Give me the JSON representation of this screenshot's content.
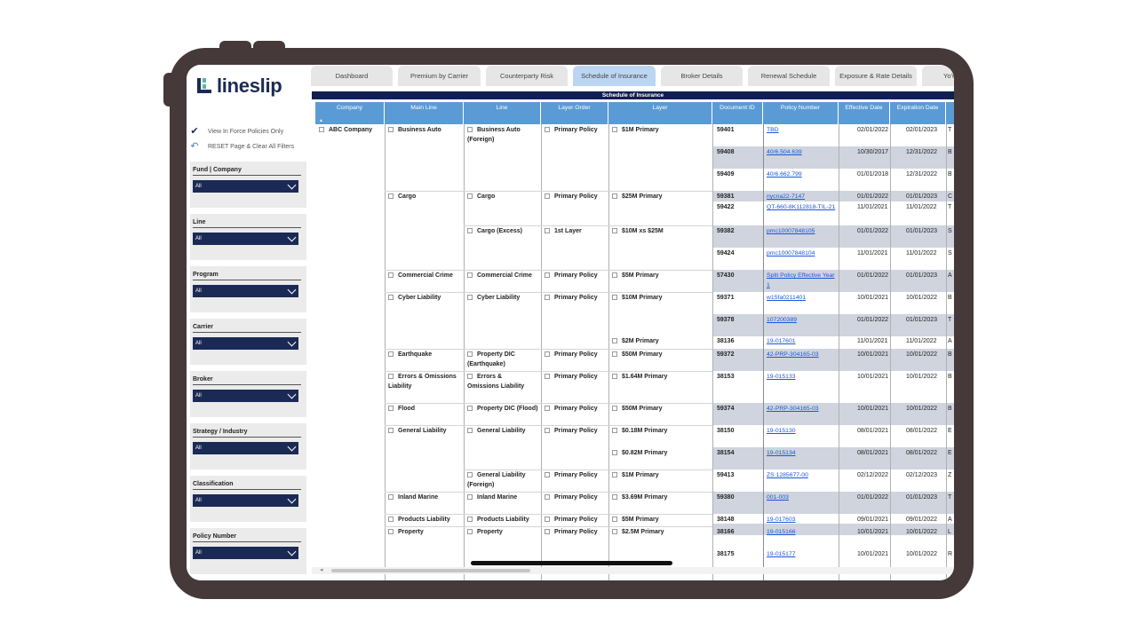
{
  "app": {
    "logo_text": "lineslip"
  },
  "sidebar": {
    "view_in_force": "View In Force Policies Only",
    "reset": "RESET Page & Clear All Filters",
    "filters": [
      {
        "label": "Fund | Company",
        "value": "All"
      },
      {
        "label": "Line",
        "value": "All"
      },
      {
        "label": "Program",
        "value": "All"
      },
      {
        "label": "Carrier",
        "value": "All"
      },
      {
        "label": "Broker",
        "value": "All"
      },
      {
        "label": "Strategy / Industry",
        "value": "All"
      },
      {
        "label": "Classification",
        "value": "All"
      },
      {
        "label": "Policy Number",
        "value": "All"
      }
    ]
  },
  "tabs": [
    {
      "label": "Dashboard"
    },
    {
      "label": "Premium by Carrier"
    },
    {
      "label": "Counterparty Risk"
    },
    {
      "label": "Schedule of Insurance",
      "active": true
    },
    {
      "label": "Broker Details"
    },
    {
      "label": "Renewal Schedule"
    },
    {
      "label": "Exposure & Rate Details"
    },
    {
      "label": "YoY"
    }
  ],
  "table": {
    "title": "Schedule of Insurance",
    "headers": [
      "Company",
      "Main Line",
      "Line",
      "Layer Order",
      "Layer",
      "Document ID",
      "Policy Number",
      "Effective Date",
      "Expiration Date"
    ],
    "company": "ABC Company",
    "main_lines": [
      "Business Auto",
      "Cargo",
      "Commercial Crime",
      "Cyber Liability",
      "Earthquake",
      "Errors & Omissions Liability",
      "Flood",
      "General Liability",
      "Inland Marine",
      "Products Liability",
      "Property"
    ],
    "lines": [
      "Business Auto (Foreign)",
      "Cargo",
      "Cargo (Excess)",
      "Commercial Crime",
      "Cyber Liability",
      "Property DIC (Earthquake)",
      "Errors & Omissions Liability",
      "Property DIC (Flood)",
      "General Liability",
      "General Liability (Foreign)",
      "Inland Marine",
      "Products Liability",
      "Property"
    ],
    "layer_orders": [
      "Primary Policy",
      "Primary Policy",
      "1st Layer",
      "Primary Policy",
      "Primary Policy",
      "Primary Policy",
      "Primary Policy",
      "Primary Policy",
      "Primary Policy",
      "Primary Policy",
      "Primary Policy",
      "Primary Policy",
      "Primary Policy"
    ],
    "layers": [
      "$1M Primary",
      "$25M Primary",
      "$10M xs $25M",
      "$5M Primary",
      "$10M Primary",
      "$2M Primary",
      "$50M Primary",
      "$1.64M Primary",
      "$50M Primary",
      "$0.18M Primary",
      "$0.82M Primary",
      "$1M Primary",
      "$3.69M Primary",
      "$5M Primary",
      "$2.5M Primary"
    ],
    "rows": [
      {
        "doc": "59401",
        "policy": "TBD",
        "eff": "02/01/2022",
        "exp": "02/01/2023",
        "extra": "T"
      },
      {
        "doc": "59408",
        "policy": "40/6.504.639",
        "eff": "10/30/2017",
        "exp": "12/31/2022",
        "extra": "B"
      },
      {
        "doc": "59409",
        "policy": "40/6.662.799",
        "eff": "01/01/2018",
        "exp": "12/31/2022",
        "extra": "B"
      },
      {
        "doc": "59381",
        "policy": "nycna22-7147",
        "eff": "01/01/2022",
        "exp": "01/01/2023",
        "extra": "C"
      },
      {
        "doc": "59422",
        "policy": "QT-660-8K112818-TIL-21",
        "eff": "11/01/2021",
        "exp": "11/01/2022",
        "extra": "T"
      },
      {
        "doc": "59382",
        "policy": "pmc10007848105",
        "eff": "01/01/2022",
        "exp": "01/01/2023",
        "extra": "S"
      },
      {
        "doc": "59424",
        "policy": "pmc10007848104",
        "eff": "11/01/2021",
        "exp": "11/01/2022",
        "extra": "S"
      },
      {
        "doc": "57430",
        "policy": "Split Policy Effective Year 1",
        "eff": "01/01/2022",
        "exp": "01/01/2023",
        "extra": "A"
      },
      {
        "doc": "59371",
        "policy": "w15fa0211401",
        "eff": "10/01/2021",
        "exp": "10/01/2022",
        "extra": "B"
      },
      {
        "doc": "59378",
        "policy": "107200389",
        "eff": "01/01/2022",
        "exp": "01/01/2023",
        "extra": "T"
      },
      {
        "doc": "38136",
        "policy": "19-017601",
        "eff": "11/01/2021",
        "exp": "11/01/2022",
        "extra": "A"
      },
      {
        "doc": "59372",
        "policy": "42-PRP-304165-03",
        "eff": "10/01/2021",
        "exp": "10/01/2022",
        "extra": "B"
      },
      {
        "doc": "38153",
        "policy": "19-015133",
        "eff": "10/01/2021",
        "exp": "10/01/2022",
        "extra": "B"
      },
      {
        "doc": "59374",
        "policy": "42-PRP-304165-03",
        "eff": "10/01/2021",
        "exp": "10/01/2022",
        "extra": "B"
      },
      {
        "doc": "38150",
        "policy": "19-015130",
        "eff": "08/01/2021",
        "exp": "08/01/2022",
        "extra": "E"
      },
      {
        "doc": "38154",
        "policy": "19-015134",
        "eff": "08/01/2021",
        "exp": "08/01/2022",
        "extra": "E"
      },
      {
        "doc": "59413",
        "policy": "ZS 1285677-00",
        "eff": "02/12/2022",
        "exp": "02/12/2023",
        "extra": "Z"
      },
      {
        "doc": "59380",
        "policy": "001-003",
        "eff": "01/01/2022",
        "exp": "01/01/2023",
        "extra": "T"
      },
      {
        "doc": "38148",
        "policy": "19-017603",
        "eff": "09/01/2021",
        "exp": "09/01/2022",
        "extra": "A"
      },
      {
        "doc": "38166",
        "policy": "19-015166",
        "eff": "10/01/2021",
        "exp": "10/01/2022",
        "extra": "L"
      },
      {
        "doc": "38175",
        "policy": "19-015177",
        "eff": "10/01/2021",
        "exp": "10/01/2022",
        "extra": "R"
      }
    ]
  }
}
